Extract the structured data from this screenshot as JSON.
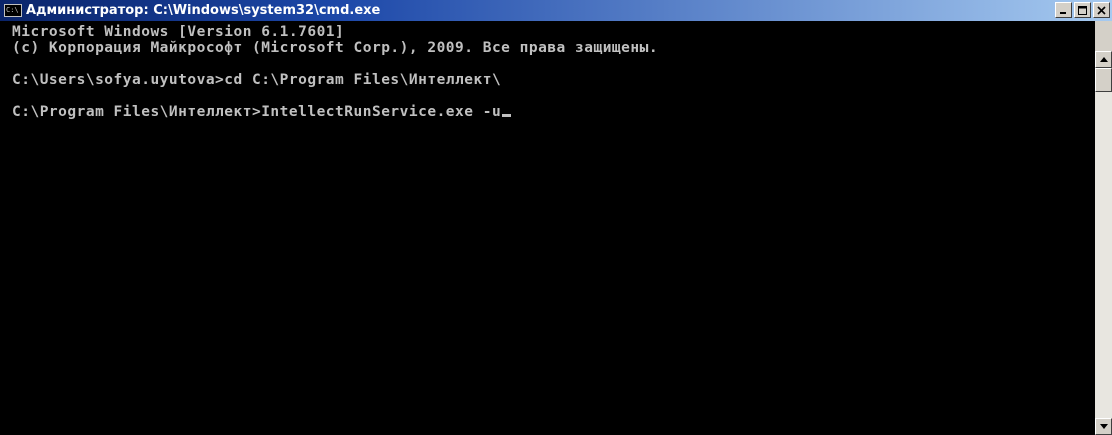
{
  "window": {
    "title": "Администратор: C:\\Windows\\system32\\cmd.exe",
    "icon": "cmd-icon",
    "icon_text": "C:\\",
    "buttons": [
      "minimize-icon",
      "maximize-icon",
      "close-icon"
    ]
  },
  "console": {
    "lines": [
      "Microsoft Windows [Version 6.1.7601]",
      "(c) Корпорация Майкрософт (Microsoft Corp.), 2009. Все права защищены.",
      "",
      "C:\\Users\\sofya.uyutova>cd C:\\Program Files\\Интеллект\\",
      "",
      "C:\\Program Files\\Интеллект>IntellectRunService.exe -u"
    ],
    "text_color": "#c0c0c0",
    "background": "#000000"
  },
  "scrollbar": {
    "up_icon": "arrow-up-icon",
    "down_icon": "arrow-down-icon"
  }
}
